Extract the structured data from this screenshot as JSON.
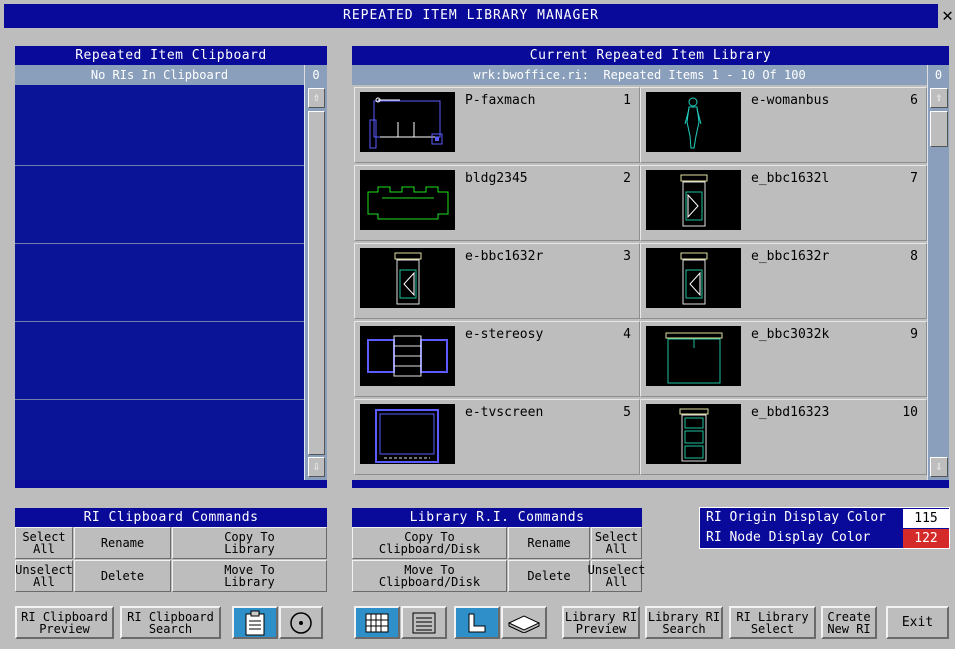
{
  "window": {
    "title": "REPEATED ITEM LIBRARY MANAGER",
    "close_glyph": "✕"
  },
  "clipboard": {
    "title": "Repeated Item Clipboard",
    "status": "No RIs In Clipboard",
    "count": "0"
  },
  "library": {
    "title": "Current Repeated Item Library",
    "file": "wrk:bwoffice.ri:",
    "range_text": "Repeated Items 1 - 10 Of 100",
    "count": "0",
    "items": [
      {
        "name": "P-faxmach",
        "num": "1"
      },
      {
        "name": "e-womanbus",
        "num": "6"
      },
      {
        "name": "bldg2345",
        "num": "2"
      },
      {
        "name": "e_bbc1632l",
        "num": "7"
      },
      {
        "name": "e-bbc1632r",
        "num": "3"
      },
      {
        "name": "e_bbc1632r",
        "num": "8"
      },
      {
        "name": "e-stereosy",
        "num": "4"
      },
      {
        "name": "e_bbc3032k",
        "num": "9"
      },
      {
        "name": "e-tvscreen",
        "num": "5"
      },
      {
        "name": "e_bbd16323",
        "num": "10"
      }
    ]
  },
  "clip_cmds": {
    "title": "RI Clipboard Commands",
    "select_all": "Select\nAll",
    "rename": "Rename",
    "copy_to_library": "Copy To\nLibrary",
    "unselect_all": "Unselect\nAll",
    "delete": "Delete",
    "move_to_library": "Move To\nLibrary"
  },
  "lib_cmds": {
    "title": "Library R.I. Commands",
    "copy_to_clipboard": "Copy To\nClipboard/Disk",
    "rename": "Rename",
    "select_all": "Select\nAll",
    "move_to_clipboard": "Move To\nClipboard/Disk",
    "delete": "Delete",
    "unselect_all": "Unselect\nAll"
  },
  "colors": {
    "origin_label": "RI Origin Display Color",
    "origin_value": "115",
    "node_label": "RI Node Display Color",
    "node_value": "122",
    "node_swatch": "#d42a2a",
    "origin_swatch": "#ffffff",
    "accent": "#0a0a9a"
  },
  "bottom": {
    "clip_preview": "RI Clipboard\nPreview",
    "clip_search": "RI Clipboard\nSearch",
    "lib_preview": "Library RI\nPreview",
    "lib_search": "Library RI\nSearch",
    "lib_select": "RI Library\nSelect",
    "create_new": "Create\nNew RI",
    "exit": "Exit"
  }
}
